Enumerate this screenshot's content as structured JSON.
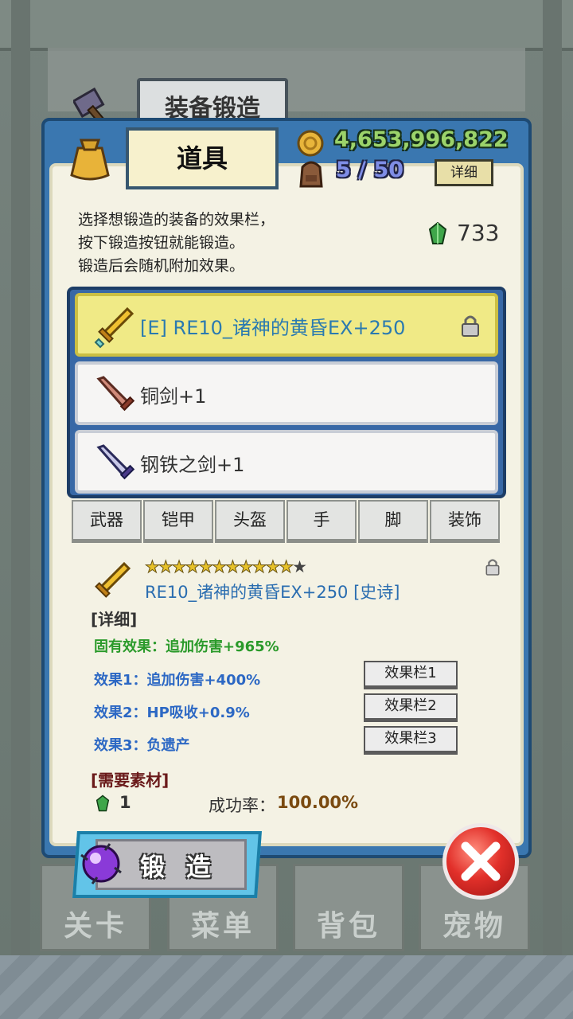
{
  "background": {
    "nav": [
      "关卡",
      "菜单",
      "背包",
      "宠物"
    ]
  },
  "header": {
    "title": "装备锻造",
    "tab": "道具",
    "gold": "4,653,996,822",
    "inventory": "5 / 50",
    "detail_button": "详细"
  },
  "intro": {
    "lines": [
      "选择想锻造的装备的效果栏，",
      "按下锻造按钮就能锻造。",
      "锻造后会随机附加效果。"
    ],
    "gem_count": "733"
  },
  "equipment_list": [
    {
      "name": "[E] RE10_诸神的黄昏EX+250",
      "selected": true,
      "locked": true,
      "icon": "golden-sword-icon"
    },
    {
      "name": "铜剑+1",
      "selected": false,
      "locked": false,
      "icon": "copper-sword-icon"
    },
    {
      "name": "钢铁之剑+1",
      "selected": false,
      "locked": false,
      "icon": "steel-sword-icon"
    }
  ],
  "categories": [
    "武器",
    "铠甲",
    "头盔",
    "手",
    "脚",
    "装饰"
  ],
  "detail": {
    "stars_filled": 11,
    "stars_total": 12,
    "name": "RE10_诸神的黄昏EX+250 [史诗]",
    "section_title": "[详细]",
    "inherent": "固有效果：追加伤害+965%",
    "effects": [
      "效果1：追加伤害+400%",
      "效果2：HP吸收+0.9%",
      "效果3：负遗产"
    ],
    "slot_buttons": [
      "效果栏1",
      "效果栏2",
      "效果栏3"
    ],
    "materials_title": "[需要素材]",
    "material_qty": "1",
    "success_label": "成功率：",
    "success_value": "100.00%"
  },
  "forge_button": "锻 造",
  "colors": {
    "gold_text": "#9bd36a",
    "selected_item": "#f0ea86",
    "effect_blue": "#2c68c4",
    "inherent_green": "#2a9a2a"
  }
}
